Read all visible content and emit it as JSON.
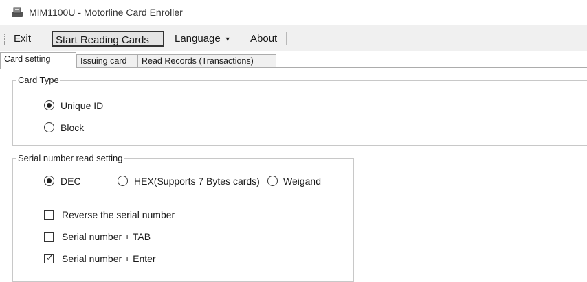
{
  "window": {
    "title": "MIM1100U - Motorline Card Enroller",
    "icon": "card-reader-icon"
  },
  "menu": {
    "exit": "Exit",
    "start_reading": "Start Reading Cards",
    "language": "Language",
    "about": "About"
  },
  "tabs": [
    {
      "label": "Card setting",
      "active": true
    },
    {
      "label": "Issuing card",
      "active": false
    },
    {
      "label": "Read Records (Transactions)",
      "active": false
    }
  ],
  "card_type": {
    "legend": "Card Type",
    "options": [
      {
        "label": "Unique ID",
        "checked": true
      },
      {
        "label": "Block",
        "checked": false
      }
    ]
  },
  "serial_setting": {
    "legend": "Serial number read setting",
    "formats": [
      {
        "label": "DEC",
        "checked": true
      },
      {
        "label": "HEX(Supports 7 Bytes cards)",
        "checked": false
      },
      {
        "label": "Weigand",
        "checked": false
      }
    ],
    "checks": [
      {
        "label": "Reverse the serial number",
        "checked": false
      },
      {
        "label": "Serial number + TAB",
        "checked": false
      },
      {
        "label": "Serial number + Enter",
        "checked": true
      }
    ]
  }
}
